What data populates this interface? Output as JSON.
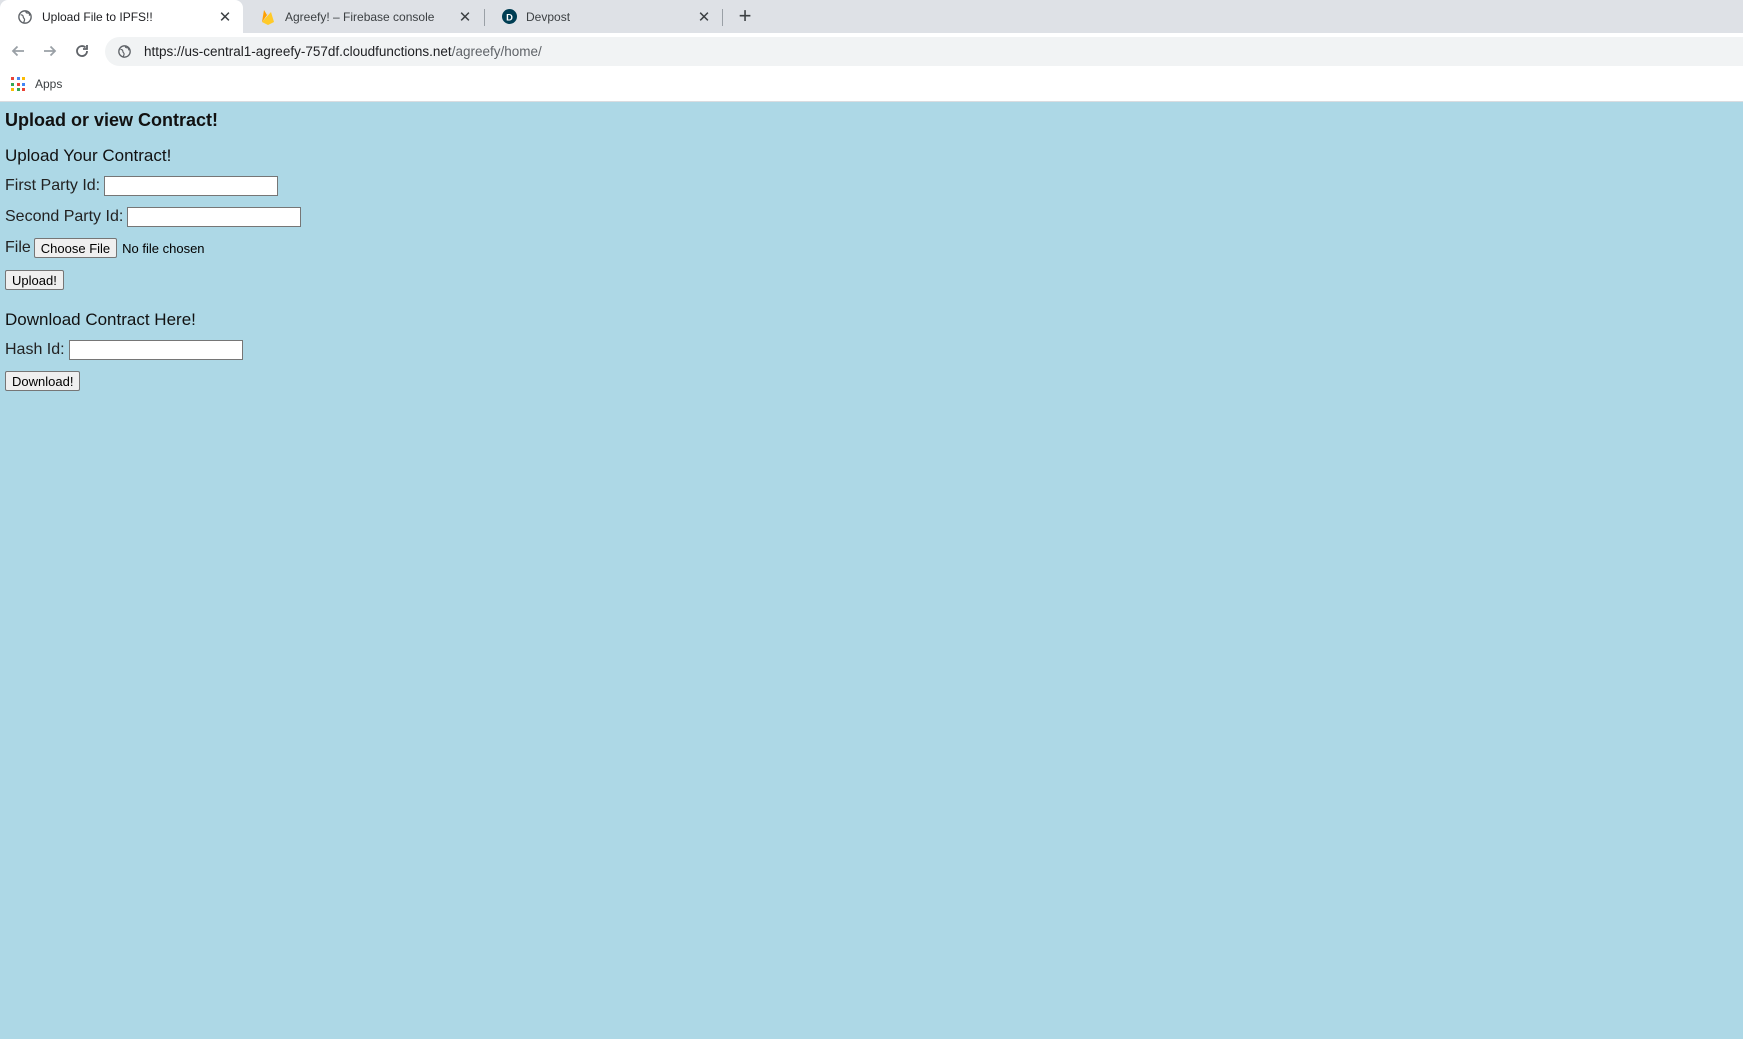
{
  "browser": {
    "tabs": [
      {
        "title": "Upload File to IPFS!!",
        "icon": "globe-icon",
        "active": true
      },
      {
        "title": "Agreefy! – Firebase console",
        "icon": "firebase-icon",
        "active": false
      },
      {
        "title": "Devpost",
        "icon": "devpost-icon",
        "active": false
      }
    ],
    "new_tab_icon": "plus-icon",
    "url_host": "https://us-central1-agreefy-757df.cloudfunctions.net",
    "url_path": "/agreefy/home/",
    "bookmarks": {
      "apps_label": "Apps"
    }
  },
  "page": {
    "heading": "Upload or view Contract!",
    "upload": {
      "heading": "Upload Your Contract!",
      "first_party_label": "First Party Id:",
      "first_party_value": "",
      "second_party_label": "Second Party Id:",
      "second_party_value": "",
      "file_label": "File",
      "choose_file_label": "Choose File",
      "file_status": "No file chosen",
      "submit_label": "Upload!"
    },
    "download": {
      "heading": "Download Contract Here!",
      "hash_label": "Hash Id:",
      "hash_value": "",
      "submit_label": "Download!"
    }
  },
  "colors": {
    "page_background": "#add8e6",
    "tabstrip_background": "#dee1e6"
  }
}
